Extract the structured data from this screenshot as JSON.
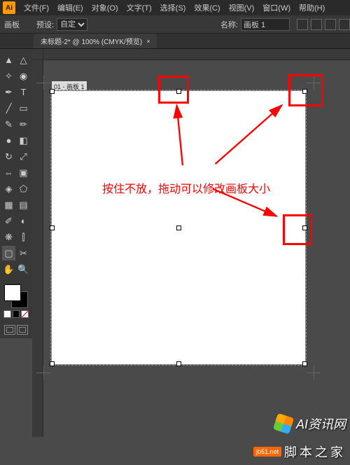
{
  "menubar": {
    "logo": "Ai",
    "items": [
      "文件(F)",
      "编辑(E)",
      "对象(O)",
      "文字(T)",
      "选择(S)",
      "效果(C)",
      "视图(V)",
      "窗口(W)",
      "帮助(H)"
    ]
  },
  "optionsbar": {
    "section_label": "画板",
    "preset_label": "预设:",
    "preset_value": "自定",
    "name_label": "名称:",
    "name_value": "画板 1"
  },
  "tab": {
    "title": "未标题-2* @ 100% (CMYK/预览)",
    "close": "×"
  },
  "artboard": {
    "label": "01 - 画板 1"
  },
  "annotation": {
    "text": "按住不放，拖动可以修改画板大小"
  },
  "watermarks": {
    "top": "AI资讯网",
    "bottom_badge": "jb51.net",
    "bottom_text": "脚本之家"
  },
  "colors": {
    "red": "#ff0000"
  }
}
